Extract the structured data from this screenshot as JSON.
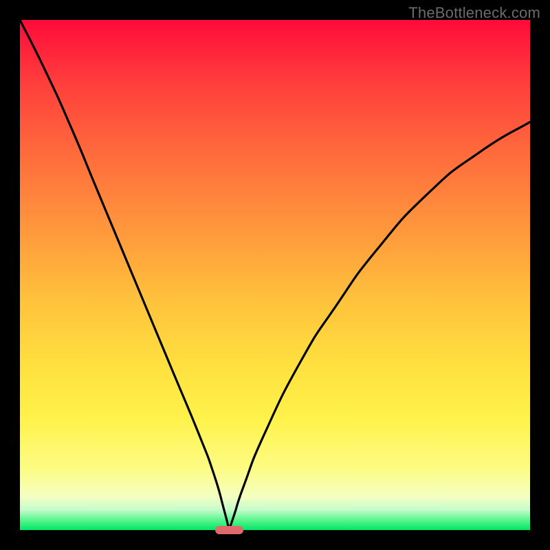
{
  "watermark": "TheBottleneck.com",
  "colors": {
    "frame_border": "#000000",
    "curve_stroke": "#000000",
    "marker_fill": "#de6a6c",
    "gradient_top": "#ff0b3a",
    "gradient_bottom": "#00e765"
  },
  "chart_data": {
    "type": "line",
    "title": "",
    "xlabel": "",
    "ylabel": "",
    "xlim": [
      0,
      100
    ],
    "ylim": [
      0,
      100
    ],
    "grid": false,
    "legend": false,
    "description": "V-shaped bottleneck curve over a vertical red→green heat gradient. The curve starts at the top-left, plunges to a cusp near x≈41 on the baseline, then rises to the right with decreasing slope. A small rounded pink marker sits at the cusp on the baseline.",
    "series": [
      {
        "name": "bottleneck-curve",
        "x": [
          0,
          5,
          10,
          15,
          20,
          25,
          30,
          35,
          38,
          40,
          41,
          42,
          44,
          48,
          55,
          62,
          70,
          80,
          90,
          100
        ],
        "values": [
          100,
          90,
          79,
          67,
          55,
          43,
          31,
          19,
          11,
          4,
          0,
          3,
          9,
          19,
          33,
          44,
          55,
          66,
          74,
          80
        ]
      }
    ],
    "marker": {
      "x": 41,
      "width_pct": 5.5
    },
    "gradient_stops": [
      {
        "pct": 0,
        "color": "#ff0b3a"
      },
      {
        "pct": 12,
        "color": "#ff3d3c"
      },
      {
        "pct": 26,
        "color": "#ff6a3c"
      },
      {
        "pct": 40,
        "color": "#ff943c"
      },
      {
        "pct": 55,
        "color": "#ffc23c"
      },
      {
        "pct": 68,
        "color": "#ffe13f"
      },
      {
        "pct": 78,
        "color": "#fff24a"
      },
      {
        "pct": 88,
        "color": "#fdfc84"
      },
      {
        "pct": 93.5,
        "color": "#f4fec2"
      },
      {
        "pct": 96,
        "color": "#c6fccb"
      },
      {
        "pct": 98,
        "color": "#5bf58e"
      },
      {
        "pct": 100,
        "color": "#00e765"
      }
    ]
  }
}
